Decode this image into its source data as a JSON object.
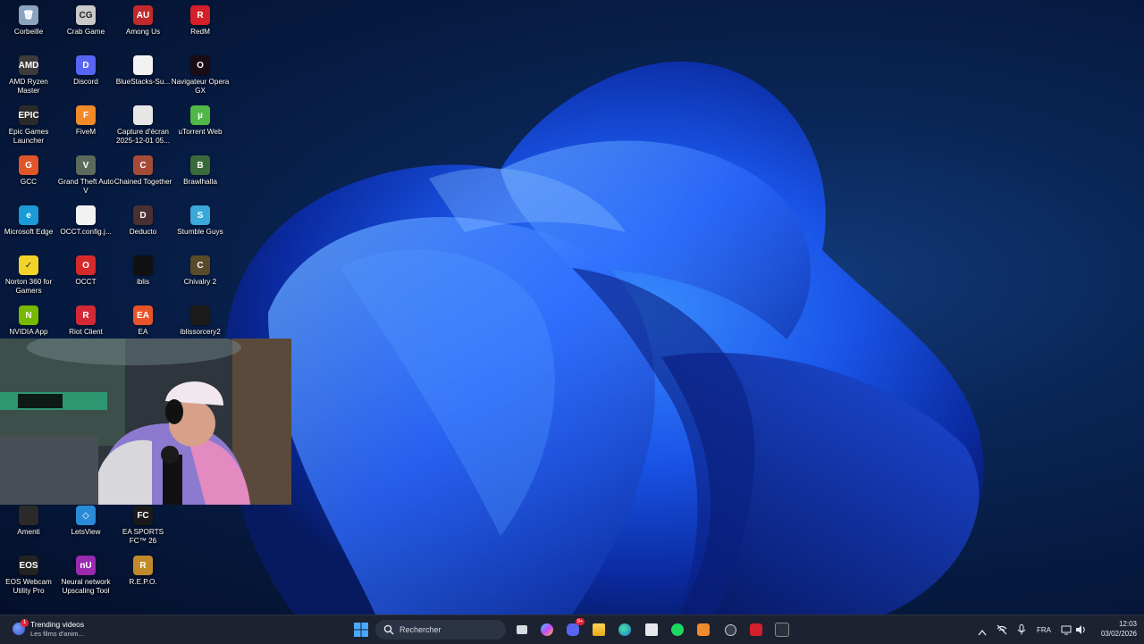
{
  "desktop": {
    "icons": [
      {
        "label": "Corbeille",
        "icon": "recycle-bin-icon",
        "color": "#8aa3bf",
        "glyph": "🗑"
      },
      {
        "label": "Crab Game",
        "icon": "crab-game-icon",
        "color": "#c9c9c9",
        "glyph": "CG"
      },
      {
        "label": "Among Us",
        "icon": "among-us-icon",
        "color": "#c02a2a",
        "glyph": "AU"
      },
      {
        "label": "RedM",
        "icon": "redm-icon",
        "color": "#d4202a",
        "glyph": "R"
      },
      {
        "label": "AMD Ryzen Master",
        "icon": "amd-ryzen-master-icon",
        "color": "#3b3b3b",
        "glyph": "AMD"
      },
      {
        "label": "Discord",
        "icon": "discord-icon",
        "color": "#5865f2",
        "glyph": "D"
      },
      {
        "label": "BlueStacks-Su...",
        "icon": "file-icon",
        "color": "#f2f2f2",
        "glyph": ""
      },
      {
        "label": "Navigateur Opera GX",
        "icon": "opera-gx-icon",
        "color": "#1a0b14",
        "glyph": "O"
      },
      {
        "label": "Epic Games Launcher",
        "icon": "epic-games-icon",
        "color": "#2a2a2a",
        "glyph": "EPIC"
      },
      {
        "label": "FiveM",
        "icon": "fivem-icon",
        "color": "#f08a2a",
        "glyph": "F"
      },
      {
        "label": "Capture d'écran 2025-12-01 05...",
        "icon": "screenshot-file-icon",
        "color": "#e6e6e6",
        "glyph": ""
      },
      {
        "label": "uTorrent Web",
        "icon": "utorrent-icon",
        "color": "#4fb848",
        "glyph": "µ"
      },
      {
        "label": "GCC",
        "icon": "gcc-icon",
        "color": "#e0562a",
        "glyph": "G"
      },
      {
        "label": "Grand Theft Auto V",
        "icon": "gta-v-icon",
        "color": "#5c6a5c",
        "glyph": "V"
      },
      {
        "label": "Chained Together",
        "icon": "chained-together-icon",
        "color": "#a64a3a",
        "glyph": "C"
      },
      {
        "label": "Brawlhalla",
        "icon": "brawlhalla-icon",
        "color": "#3a6a3a",
        "glyph": "B"
      },
      {
        "label": "Microsoft Edge",
        "icon": "edge-icon",
        "color": "#1a9ad6",
        "glyph": "e"
      },
      {
        "label": "OCCT.config.j...",
        "icon": "file-icon",
        "color": "#f2f2f2",
        "glyph": ""
      },
      {
        "label": "Deducto",
        "icon": "deducto-icon",
        "color": "#4a3030",
        "glyph": "D"
      },
      {
        "label": "Stumble Guys",
        "icon": "stumble-guys-icon",
        "color": "#3aa8d8",
        "glyph": "S"
      },
      {
        "label": "Norton 360 for Gamers",
        "icon": "norton-icon",
        "color": "#f2d32a",
        "glyph": "✓"
      },
      {
        "label": "OCCT",
        "icon": "occt-icon",
        "color": "#d42a2a",
        "glyph": "O"
      },
      {
        "label": "iblis",
        "icon": "iblis-icon",
        "color": "#111111",
        "glyph": ""
      },
      {
        "label": "Chivalry 2",
        "icon": "chivalry-2-icon",
        "color": "#5a4a2a",
        "glyph": "C"
      },
      {
        "label": "NVIDIA App",
        "icon": "nvidia-icon",
        "color": "#76b900",
        "glyph": "N"
      },
      {
        "label": "Riot Client",
        "icon": "riot-client-icon",
        "color": "#d32936",
        "glyph": "R"
      },
      {
        "label": "EA",
        "icon": "ea-icon",
        "color": "#e8542a",
        "glyph": "EA"
      },
      {
        "label": "iblissorcery2",
        "icon": "iblissorcery2-icon",
        "color": "#1a1a1a",
        "glyph": ""
      },
      {
        "label": "Amenti",
        "icon": "amenti-icon",
        "color": "#2a2a2a",
        "glyph": ""
      },
      {
        "label": "LetsView",
        "icon": "letsview-icon",
        "color": "#2a8ad8",
        "glyph": "◇"
      },
      {
        "label": "EA SPORTS FC™ 26",
        "icon": "ea-sports-fc-icon",
        "color": "#1a1a1a",
        "glyph": "FC"
      },
      {
        "label": "EOS Webcam Utility Pro",
        "icon": "eos-webcam-icon",
        "color": "#222222",
        "glyph": "EOS"
      },
      {
        "label": "Neural network Upscaling Tool",
        "icon": "neural-upscale-icon",
        "color": "#9a2ab0",
        "glyph": "nU"
      },
      {
        "label": "R.E.P.O.",
        "icon": "repo-icon",
        "color": "#c08a2a",
        "glyph": "R"
      }
    ]
  },
  "taskbar": {
    "widget": {
      "title": "Trending videos",
      "subtitle": "Les films d'anim...",
      "badge": "1"
    },
    "search_placeholder": "Rechercher",
    "discord_badge": "9+",
    "language": "FRA",
    "time": "12:03",
    "date": "03/02/2026"
  }
}
